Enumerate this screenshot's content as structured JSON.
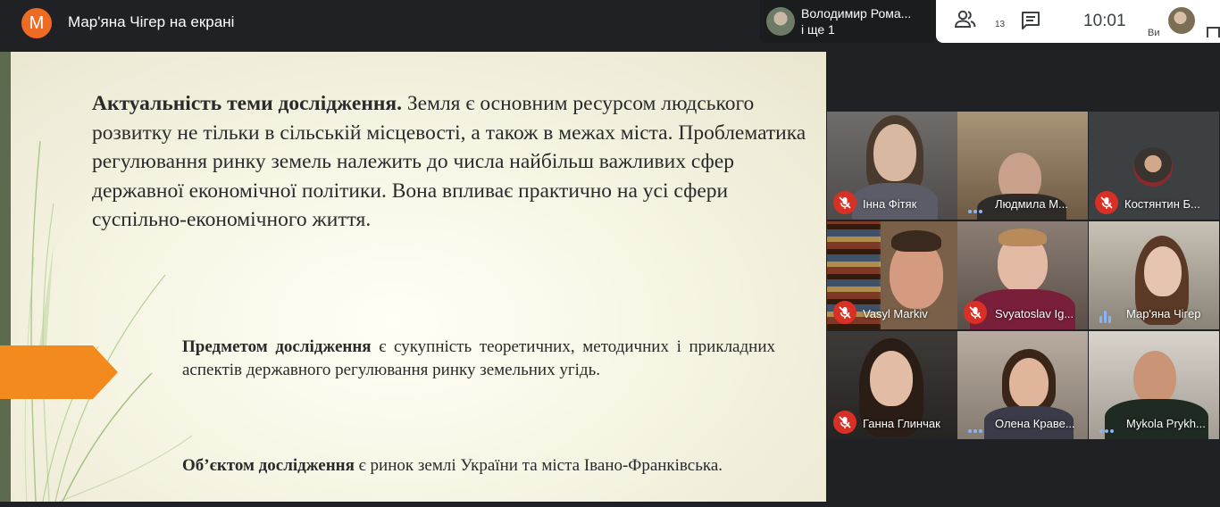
{
  "header": {
    "presenter_initial": "M",
    "presenter_title": "Мар'яна Чігер на екрані",
    "pinned_name": "Володимир Рома...",
    "pinned_more": "і ще 1",
    "people_count": "13",
    "clock": "10:01",
    "self_label": "Ви"
  },
  "slide": {
    "p1_bold": "Актуальність теми дослідження.",
    "p1_text": " Земля є основним ресурсом людського розвитку не тільки в сільській місцевості, а також в межах міста. Проблематика регулювання ринку земель належить до числа найбільш важливих сфер державної економічної політики. Вона впливає практично на усі сфери суспільно-економічного життя.",
    "p2_bold": "Предметом дослідження",
    "p2_text": " є сукупність теоретичних, методичних і прикладних аспектів державного регулювання ринку земельних угідь.",
    "p3_bold": "Об’єктом дослідження",
    "p3_text": " є ринок землі України та міста Івано-Франківська."
  },
  "participants": [
    {
      "name": "Інна Фітяк",
      "status": "muted"
    },
    {
      "name": "Людмила М...",
      "status": "dots"
    },
    {
      "name": "Костянтин Б...",
      "status": "muted"
    },
    {
      "name": "Vasyl Markiv",
      "status": "muted"
    },
    {
      "name": "Svyatoslav Ig...",
      "status": "muted"
    },
    {
      "name": "Мар'яна Чігер",
      "status": "speaking"
    },
    {
      "name": "Ганна Глинчак",
      "status": "muted"
    },
    {
      "name": "Олена Краве...",
      "status": "dots"
    },
    {
      "name": "Mykola Prykh...",
      "status": "dots"
    }
  ],
  "colors": {
    "accent_orange": "#ee6b23",
    "muted_red": "#d93025",
    "speaking_blue": "#8ab4f8"
  }
}
